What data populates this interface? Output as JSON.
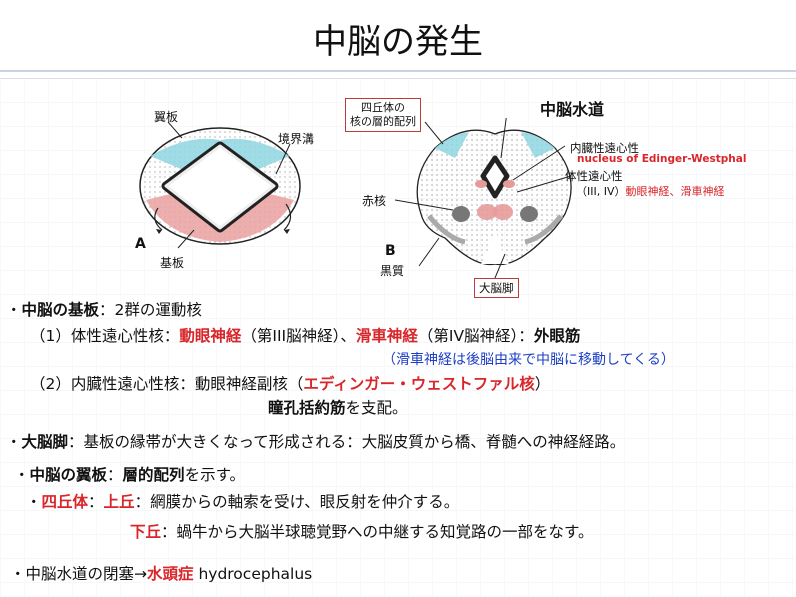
{
  "title": "中脳の発生",
  "figA": {
    "wing": "翼板",
    "sulcus": "境界溝",
    "basal": "基板",
    "letter": "A"
  },
  "figB": {
    "box1_line1": "四丘体の",
    "box1_line2": "核の層的配列",
    "aqueduct": "中脳水道",
    "visceral": "内臓性遠心性",
    "ew": "nucleus of Edinger-Westphal",
    "somatic": "体性遠心性",
    "somatic_sub": "（III, IV）",
    "somatic_sub_red": "動眼神経、滑車神経",
    "red_nucleus": "赤核",
    "letter": "B",
    "substantia": "黒質",
    "peduncle": "大脳脚"
  },
  "text": {
    "l1_bullet": "・",
    "l1_bold": "中脳の基板",
    "l1_rest": "：2群の運動核",
    "l2_a": "（1）体性遠心性核：",
    "l2_b": "動眼神経",
    "l2_c": "（第III脳神経）、",
    "l2_d": "滑車神経",
    "l2_e": "（第IV脳神経）：",
    "l2_f": "外眼筋",
    "l3": "（滑車神経は後脳由来で中脳に移動してくる）",
    "l4_a": "（2）内臓性遠心性核：動眼神経副核（",
    "l4_b": "エディンガー・ウェストファル核",
    "l4_c": "）",
    "l5_a": "瞳孔括約筋",
    "l5_b": "を支配。",
    "l6_bullet": "・",
    "l6_bold": "大脳脚",
    "l6_rest": "：基板の縁帯が大きくなって形成される：大脳皮質から橋、脊髄への神経経路。",
    "l7_bullet": "・",
    "l7_bold": "中脳の翼板",
    "l7_mid": "：",
    "l7_bold2": "層的配列",
    "l7_rest": "を示す。",
    "l8_bullet": "・",
    "l8_red1": "四丘体",
    "l8_mid": "：",
    "l8_red2": "上丘",
    "l8_rest": "：網膜からの軸索を受け、眼反射を仲介する。",
    "l9_red": "下丘",
    "l9_rest": "：蝸牛から大脳半球聴覚野への中継する知覚路の一部をなす。",
    "l10_a": "・中脳水道の閉塞→",
    "l10_b": "水頭症",
    "l10_c": " hydrocephalus"
  },
  "colors": {
    "accent_red": "#d9262b",
    "accent_blue": "#1d3fc4",
    "wing_cyan": "#7fd3de",
    "basal_red": "#e79a9a"
  }
}
